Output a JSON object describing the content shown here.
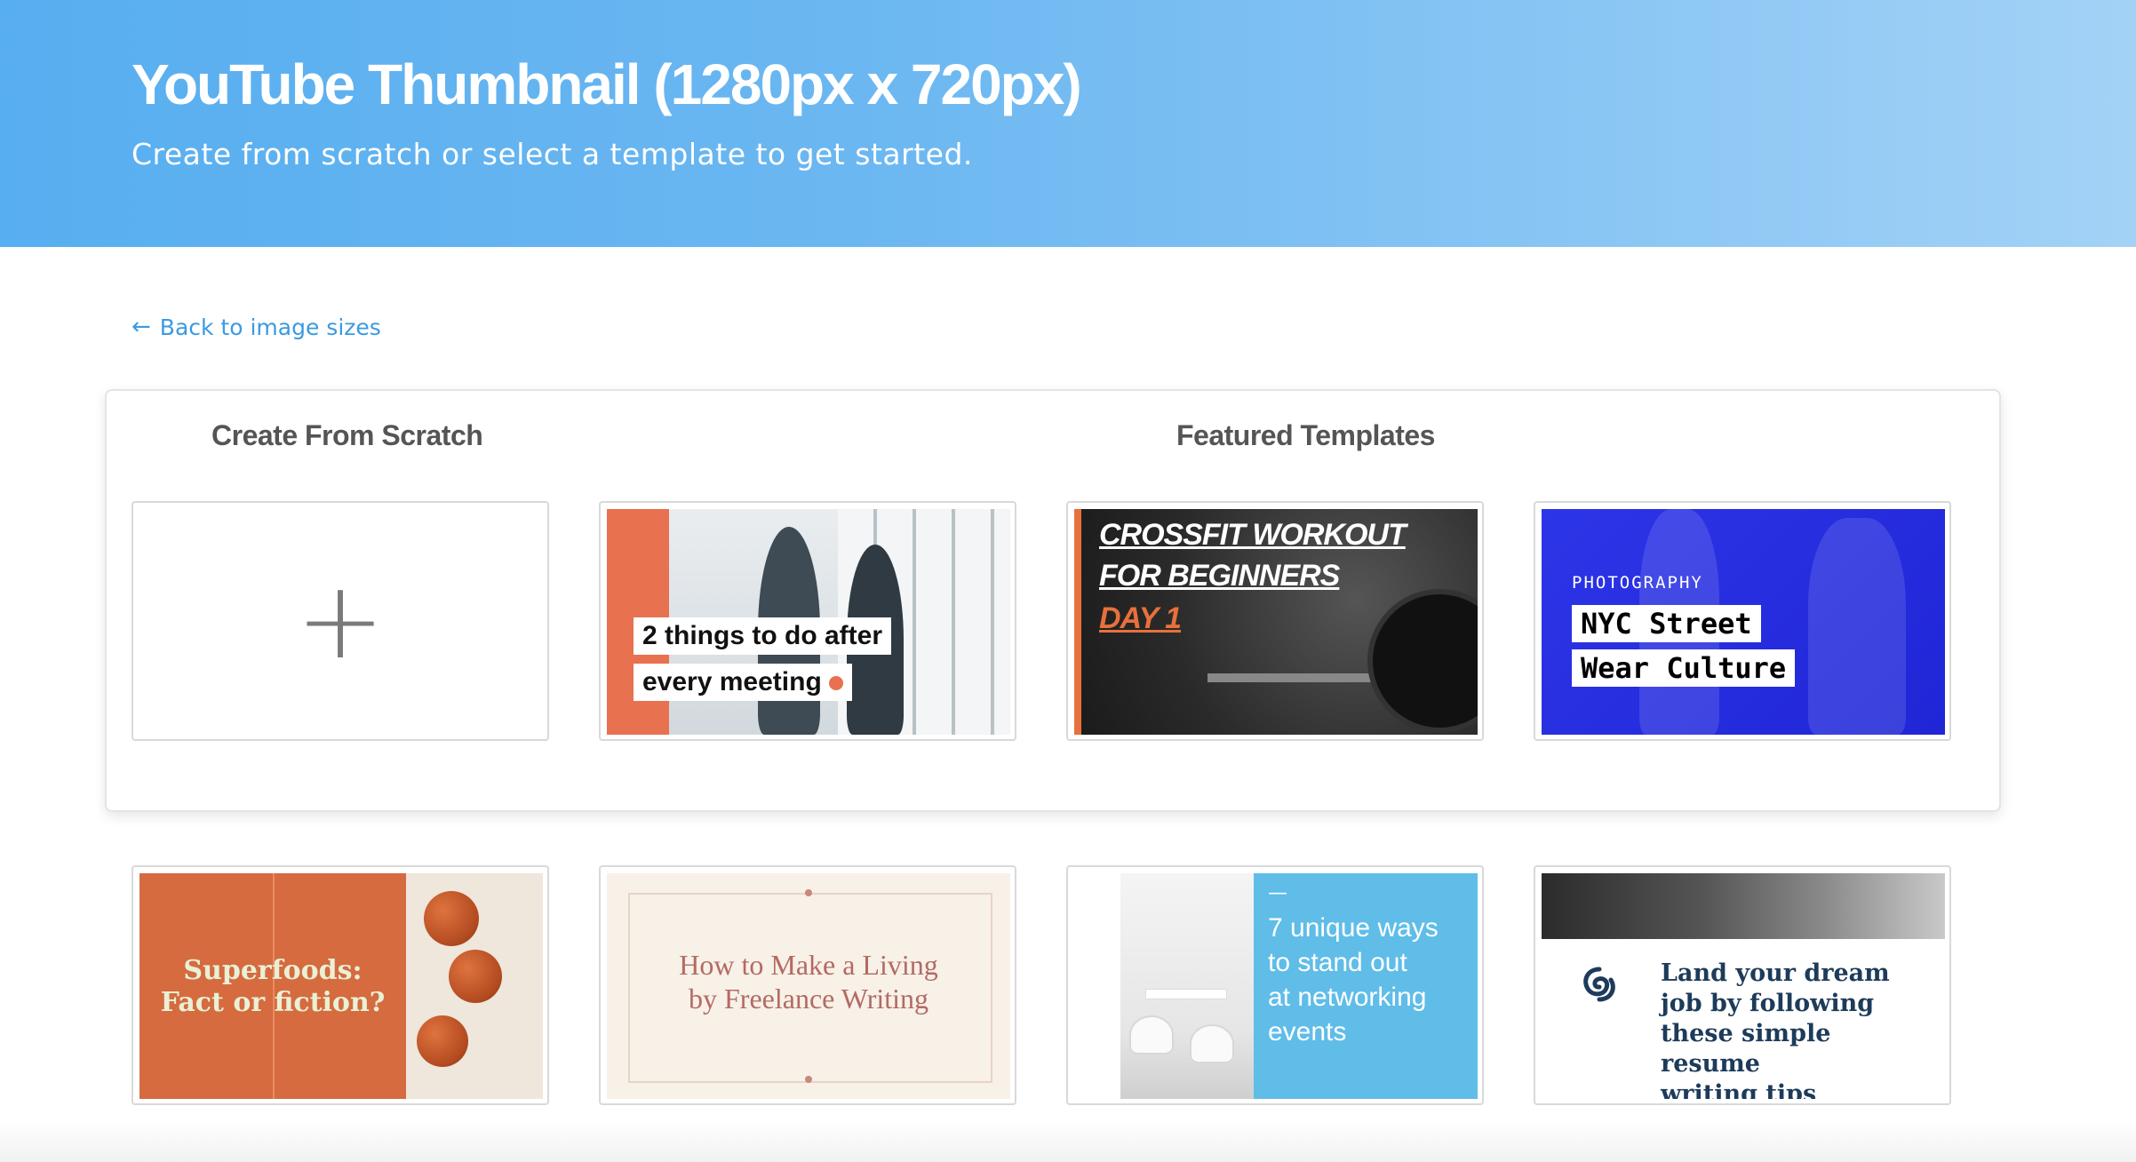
{
  "hero": {
    "title": "YouTube Thumbnail (1280px x 720px)",
    "subtitle": "Create from scratch or select a template to get started."
  },
  "back_link": {
    "label": "Back to image sizes",
    "icon": "arrow-left-icon"
  },
  "scratch": {
    "heading": "Create From Scratch",
    "plus_symbol": "+"
  },
  "featured": {
    "heading": "Featured Templates"
  },
  "templates": {
    "meeting": {
      "line1": "2 things to do after",
      "line2": "every meeting"
    },
    "crossfit": {
      "line1": "CROSSFIT WORKOUT",
      "line2": "FOR BEGINNERS",
      "line3": "DAY 1"
    },
    "nyc": {
      "kicker": "PHOTOGRAPHY",
      "line1": "NYC Street",
      "line2": "Wear Culture"
    },
    "superfoods": {
      "line1": "Superfoods:",
      "line2": "Fact or fiction?"
    },
    "freelance": {
      "line1": "How to Make a Living",
      "line2": "by Freelance Writing"
    },
    "networking": {
      "dash": "—",
      "line1": "7 unique ways",
      "line2": "to stand out",
      "line3": "at networking",
      "line4": "events"
    },
    "resume": {
      "icon": "swirl-logo-icon",
      "line1": "Land your dream",
      "line2": "job by following",
      "line3": "these simple resume",
      "line4": "writing tips"
    }
  },
  "colors": {
    "hero_start": "#57aef0",
    "hero_end": "#a3d2f6",
    "link": "#3a9ae2",
    "heading": "#555555",
    "accent_orange": "#e8714f",
    "nyc_blue": "#2d35e8",
    "networking_blue": "#5fbde8",
    "resume_navy": "#1d3b5a"
  }
}
